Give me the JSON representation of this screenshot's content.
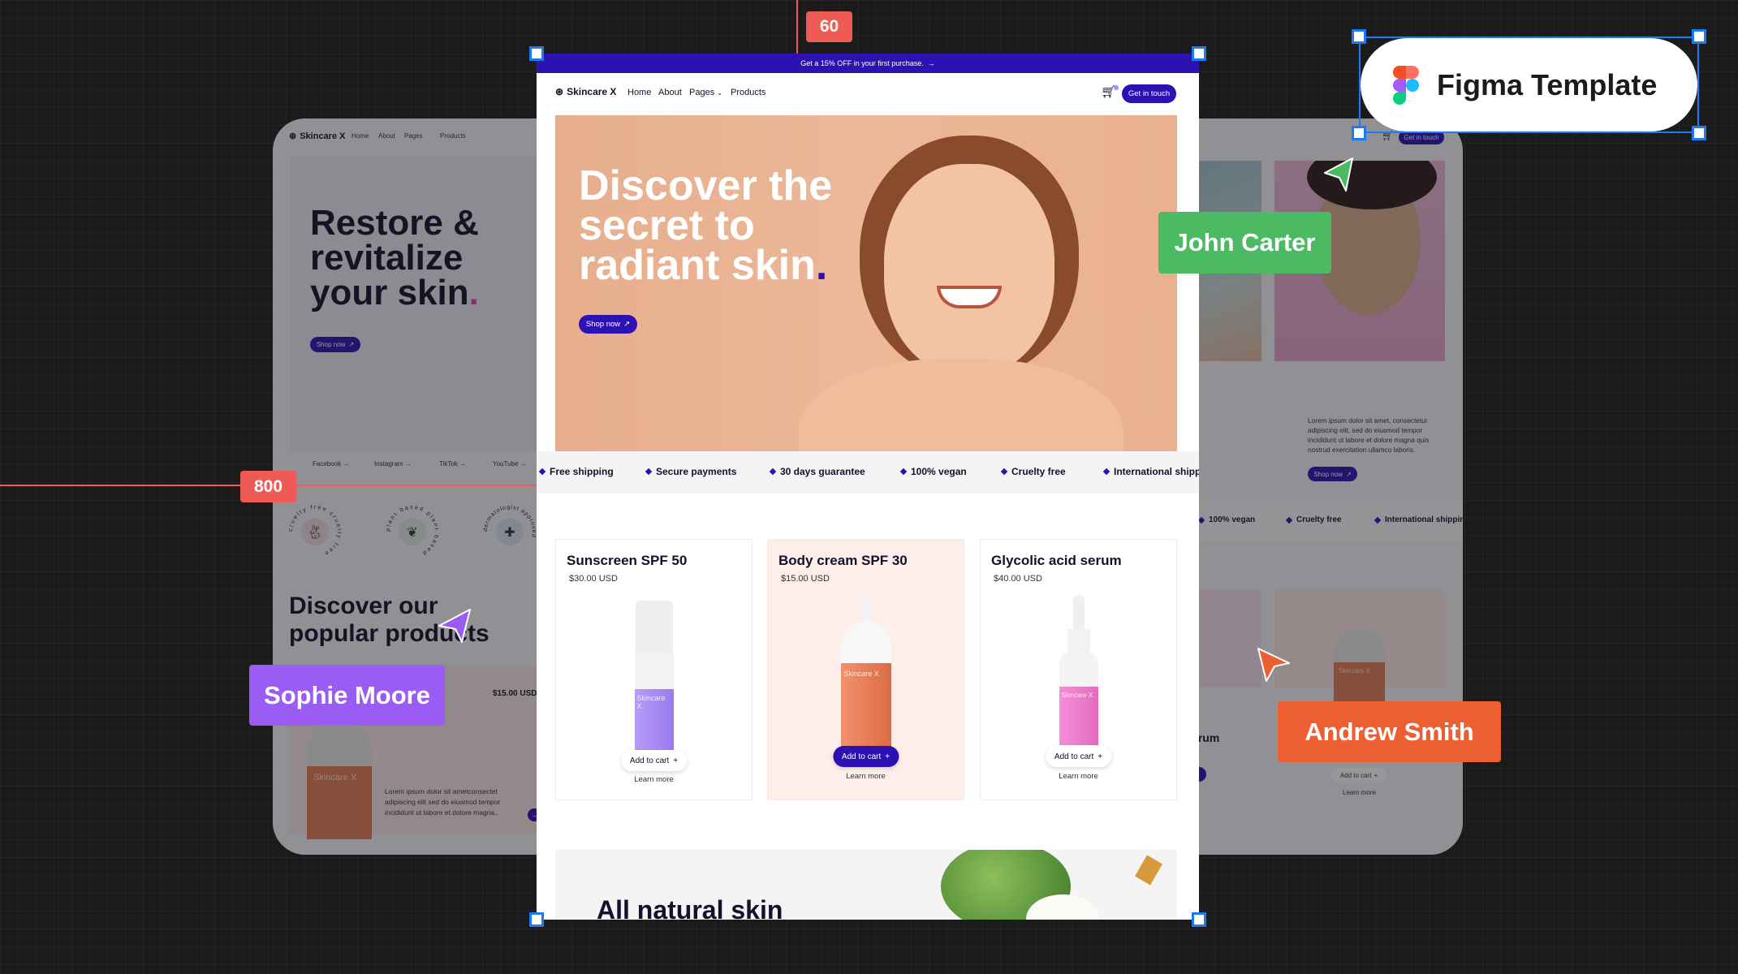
{
  "guides": {
    "top_distance": "60",
    "left_distance": "800"
  },
  "figma_label": {
    "text": "Figma Template",
    "icon": "figma-logo-icon"
  },
  "collaborators": [
    {
      "name": "John Carter",
      "color": "#4cb963"
    },
    {
      "name": "Sophie Moore",
      "color": "#9b5cf6"
    },
    {
      "name": "Andrew Smith",
      "color": "#ec5f32"
    }
  ],
  "colors": {
    "brand": "#2d11b3",
    "accent_dot": "#2d11b3",
    "hero_bg": "#e9b596",
    "highlight_card": "#fdeee9"
  },
  "main_page": {
    "announcement": "Get a 15% OFF in your first purchase.",
    "announcement_icon": "arrow-right-icon",
    "nav": {
      "logo": "Skincare X",
      "links": [
        "Home",
        "About",
        "Pages",
        "Products"
      ],
      "cta": "Get in touch",
      "cart_icon": "cart-icon"
    },
    "hero": {
      "title_1": "Discover the",
      "title_2": "secret to",
      "title_3": "radiant skin",
      "dot": ".",
      "button": "Shop now"
    },
    "features": [
      "Free shipping",
      "Secure payments",
      "30 days guarantee",
      "100% vegan",
      "Cruelty free",
      "International shipping"
    ],
    "products": [
      {
        "name": "Sunscreen SPF 50",
        "price": "$30.00 USD",
        "add_to_cart": "Add to cart",
        "learn_more": "Learn more",
        "bottle_label": "Skincare X"
      },
      {
        "name": "Body cream SPF 30",
        "price": "$15.00 USD",
        "add_to_cart": "Add to cart",
        "learn_more": "Learn more",
        "bottle_label": "Skincare X"
      },
      {
        "name": "Glycolic acid serum",
        "price": "$40.00 USD",
        "add_to_cart": "Add to cart",
        "learn_more": "Learn more",
        "bottle_label": "Skincare X"
      }
    ],
    "bottom_title": "All natural skin"
  },
  "left_preview": {
    "nav": {
      "logo": "Skincare X",
      "links": [
        "Home",
        "About",
        "Pages",
        "Products"
      ]
    },
    "hero": {
      "title_1": "Restore &",
      "title_2": "revitalize",
      "title_3": "your skin",
      "dot": ".",
      "button": "Shop now"
    },
    "socials": [
      "Facebook",
      "Instagram",
      "TikTok",
      "YouTube"
    ],
    "badges": [
      "cruelty free  cruelty free",
      "plant based  plant based",
      "dermatologist approved"
    ],
    "section_title_1": "Discover our",
    "section_title_2": "popular products",
    "product": {
      "price": "$15.00 USD",
      "description": "Lorem ipsum dolor sit ametconsectet adipiscing elit sed do eiusmod tempor incididunt ut labore et dolore magna..",
      "bottle_label": "Skincare X"
    }
  },
  "right_preview": {
    "nav": {
      "cta": "Get in touch"
    },
    "description": "Lorem ipsum dolor sit amet, consectetur adipiscing elit, sed do eiusmod tempor incididunt ut labore et dolore magna quis nostrud exercitation ullamco laboris.",
    "button": "Shop now",
    "features": [
      "100% vegan",
      "Cruelty free",
      "International shippin"
    ],
    "product_title": "Glycolic acid serum",
    "add_to_cart": "Add to cart",
    "learn_more": "Learn more",
    "bottle_label": "Skincare X"
  }
}
